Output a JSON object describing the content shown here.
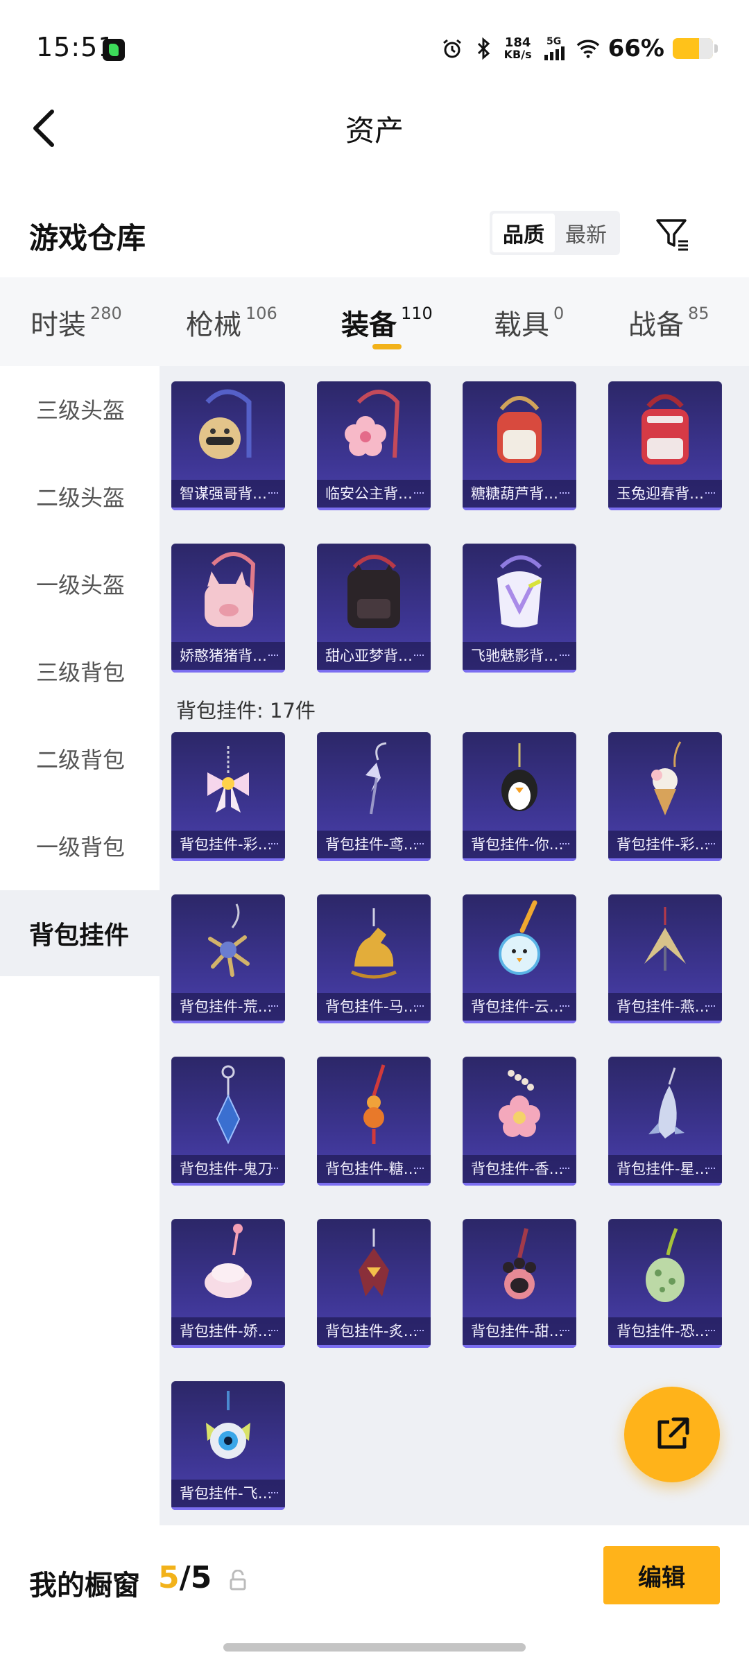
{
  "status_bar": {
    "time": "15:51",
    "net_speed_value": "184",
    "net_speed_unit": "KB/s",
    "signal_label": "5G",
    "battery_pct": "66%"
  },
  "header": {
    "title": "资产"
  },
  "warehouse": {
    "title": "游戏仓库",
    "sort_options": [
      "品质",
      "最新"
    ],
    "active_sort": "品质"
  },
  "tabs": [
    {
      "label": "时装",
      "count": "280"
    },
    {
      "label": "枪械",
      "count": "106"
    },
    {
      "label": "装备",
      "count": "110"
    },
    {
      "label": "载具",
      "count": "0"
    },
    {
      "label": "战备",
      "count": "85"
    }
  ],
  "active_tab": "装备",
  "sidebar": [
    {
      "label": "三级头盔"
    },
    {
      "label": "二级头盔"
    },
    {
      "label": "一级头盔"
    },
    {
      "label": "三级背包"
    },
    {
      "label": "二级背包"
    },
    {
      "label": "一级背包"
    },
    {
      "label": "背包挂件"
    }
  ],
  "active_sidebar": "背包挂件",
  "backpacks": [
    {
      "name": "智谋强哥背…",
      "icon": "mask-backpack"
    },
    {
      "name": "临安公主背…",
      "icon": "flower-backpack"
    },
    {
      "name": "糖糖葫芦背…",
      "icon": "gourd-backpack"
    },
    {
      "name": "玉兔迎春背…",
      "icon": "red-backpack"
    },
    {
      "name": "娇憨猪猪背…",
      "icon": "pig-backpack"
    },
    {
      "name": "甜心亚梦背…",
      "icon": "black-backpack"
    },
    {
      "name": "飞驰魅影背…",
      "icon": "white-backpack"
    }
  ],
  "charms_section_label": "背包挂件: 17件",
  "charms": [
    {
      "name": "背包挂件-彩…",
      "icon": "bow-charm"
    },
    {
      "name": "背包挂件-鸢…",
      "icon": "butterfly-charm"
    },
    {
      "name": "背包挂件-你…",
      "icon": "penguin-charm"
    },
    {
      "name": "背包挂件-彩…",
      "icon": "ice-cream-charm"
    },
    {
      "name": "背包挂件-荒…",
      "icon": "claw-charm"
    },
    {
      "name": "背包挂件-马…",
      "icon": "horse-charm"
    },
    {
      "name": "背包挂件-云…",
      "icon": "round-face-charm"
    },
    {
      "name": "背包挂件-燕…",
      "icon": "swallow-charm"
    },
    {
      "name": "背包挂件-鬼刀",
      "icon": "gem-charm"
    },
    {
      "name": "背包挂件-糖…",
      "icon": "gourd-charm"
    },
    {
      "name": "背包挂件-香…",
      "icon": "blossom-charm"
    },
    {
      "name": "背包挂件-星…",
      "icon": "shuttle-charm"
    },
    {
      "name": "背包挂件-娇…",
      "icon": "cake-charm"
    },
    {
      "name": "背包挂件-炙…",
      "icon": "bird-charm"
    },
    {
      "name": "背包挂件-甜…",
      "icon": "paw-charm"
    },
    {
      "name": "背包挂件-恐…",
      "icon": "egg-charm"
    },
    {
      "name": "背包挂件-飞…",
      "icon": "eye-charm"
    }
  ],
  "bottom_bar": {
    "showcase_label": "我的橱窗",
    "showcase_current": "5",
    "showcase_total": "/5",
    "edit_label": "编辑"
  },
  "colors": {
    "accent": "#ffb31a",
    "indicator": "#f2b21a",
    "card_top": "#2c2768",
    "card_bottom": "#4b41ad"
  }
}
